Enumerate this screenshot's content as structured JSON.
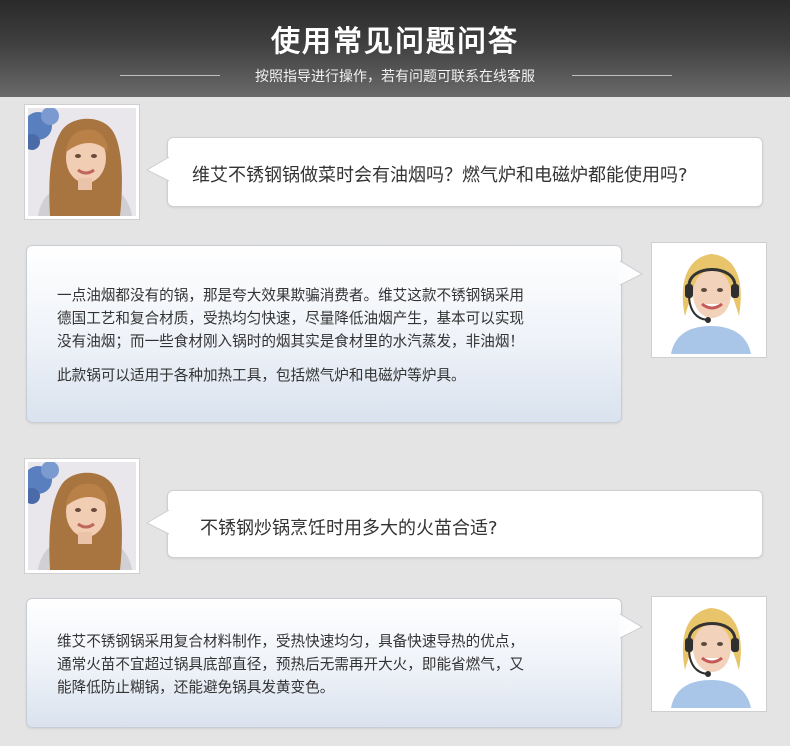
{
  "header": {
    "title": "使用常见问题问答",
    "subtitle": "按照指导进行操作，若有问题可联系在线客服"
  },
  "qa": [
    {
      "question": "维艾不锈钢锅做菜时会有油烟吗？燃气炉和电磁炉都能使用吗?",
      "answer_lines": [
        "一点油烟都没有的锅，那是夸大效果欺骗消费者。维艾这款不锈钢锅采用",
        "德国工艺和复合材质，受热均匀快速，尽量降低油烟产生，基本可以实现",
        "没有油烟；而一些食材刚入锅时的烟其实是食材里的水汽蒸发，非油烟！"
      ],
      "answer_extra": "此款锅可以适用于各种加热工具，包括燃气炉和电磁炉等炉具。"
    },
    {
      "question": "不锈钢炒锅烹饪时用多大的火苗合适?",
      "answer_lines": [
        "维艾不锈钢锅采用复合材料制作，受热快速均匀，具备快速导热的优点，",
        "通常火苗不宜超过锅具底部直径，预热后无需再开大火，即能省燃气，又",
        "能降低防止糊锅，还能避免锅具发黄变色。"
      ]
    }
  ]
}
